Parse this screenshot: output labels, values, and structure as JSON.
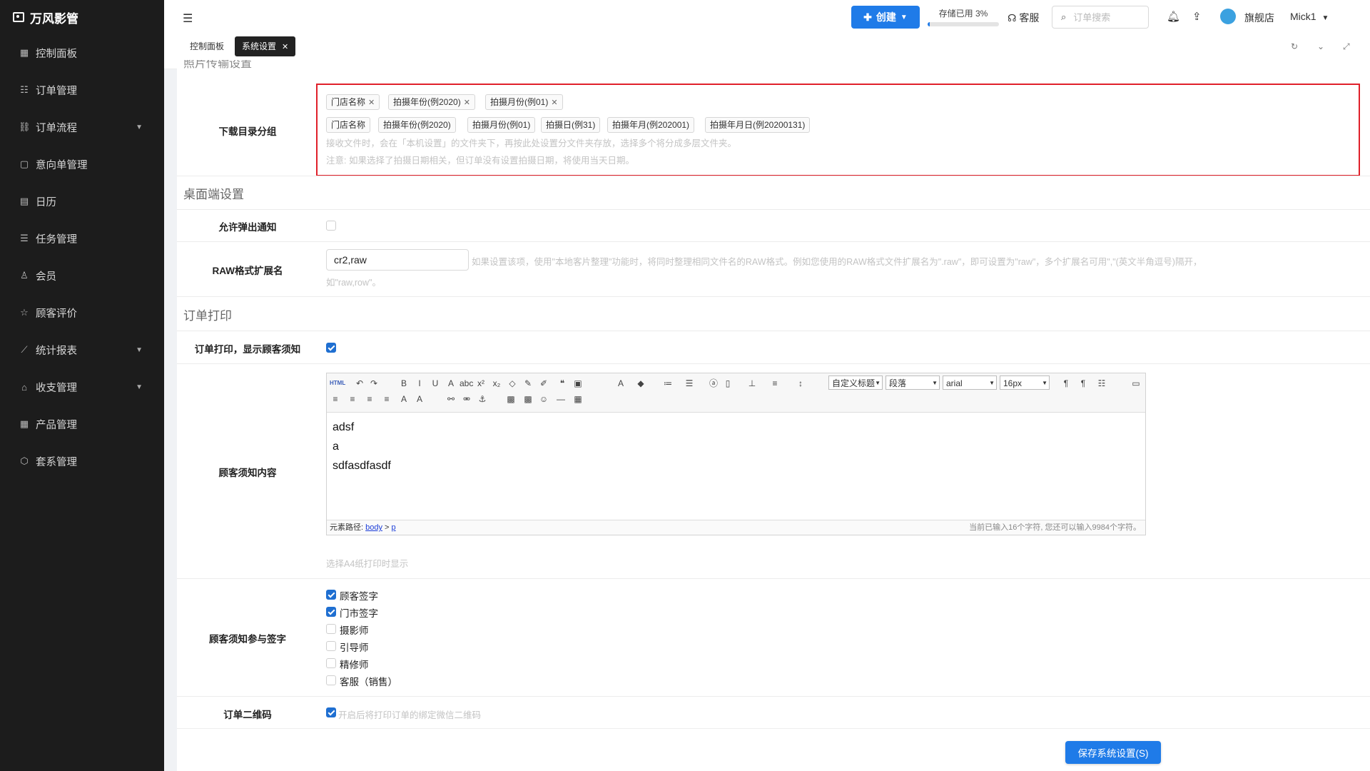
{
  "app": {
    "name": "万风影管"
  },
  "sidebar": {
    "items": [
      {
        "label": "控制面板",
        "icon": "▦",
        "chevron": false
      },
      {
        "label": "订单管理",
        "icon": "☷",
        "chevron": false
      },
      {
        "label": "订单流程",
        "icon": "⛓",
        "chevron": true
      },
      {
        "label": "意向单管理",
        "icon": "▢",
        "chevron": false
      },
      {
        "label": "日历",
        "icon": "▤",
        "chevron": false
      },
      {
        "label": "任务管理",
        "icon": "☰",
        "chevron": false
      },
      {
        "label": "会员",
        "icon": "♙",
        "chevron": false
      },
      {
        "label": "顾客评价",
        "icon": "☆",
        "chevron": false
      },
      {
        "label": "统计报表",
        "icon": "⟋",
        "chevron": true
      },
      {
        "label": "收支管理",
        "icon": "⌂",
        "chevron": true
      },
      {
        "label": "产品管理",
        "icon": "▦",
        "chevron": false
      },
      {
        "label": "套系管理",
        "icon": "⬡",
        "chevron": false
      }
    ]
  },
  "header": {
    "create_label": "创建",
    "storage_text": "存储已用 3%",
    "storage_percent": 3,
    "service_label": "客服",
    "search_placeholder": "订单搜索",
    "shop_label": "旗舰店",
    "user_label": "Mick1"
  },
  "tabs": {
    "home": "控制面板",
    "active": "系统设置"
  },
  "download": {
    "cut_title": "照片传输设置",
    "label": "下载目录分组",
    "selected": [
      "门店名称",
      "拍摄年份(例2020)",
      "拍摄月份(例01)"
    ],
    "options": [
      "门店名称",
      "拍摄年份(例2020)",
      "拍摄月份(例01)",
      "拍摄日(例31)",
      "拍摄年月(例202001)",
      "拍摄年月日(例20200131)"
    ],
    "hint1": "接收文件时，会在「本机设置」的文件夹下，再按此处设置分文件夹存放，选择多个将分成多层文件夹。",
    "hint2": "注意: 如果选择了拍摄日期相关，但订单没有设置拍摄日期，将使用当天日期。"
  },
  "desktop": {
    "title": "桌面端设置",
    "popup_label": "允许弹出通知",
    "popup_checked": false,
    "raw_label": "RAW格式扩展名",
    "raw_value": "cr2,raw",
    "raw_hint1": "如果设置该项，使用\"本地客片整理\"功能时，将同时整理相同文件名的RAW格式。例如您使用的RAW格式文件扩展名为\".raw\"，即可设置为\"raw\"，多个扩展名可用\",\"(英文半角逗号)隔开，",
    "raw_hint2": "如\"raw,row\"。"
  },
  "print": {
    "title": "订单打印",
    "show_notice_label": "订单打印，显示顾客须知",
    "show_notice_checked": true,
    "notice_label": "顾客须知内容",
    "editor": {
      "lines": [
        "adsf",
        "a",
        "sdfasdfasdf"
      ],
      "path_label": "元素路径: ",
      "path_body": "body",
      "path_sep": " > ",
      "path_p": "p",
      "count_text": "当前已输入16个字符, 您还可以输入9984个字符。",
      "sel_title": "自定义标题",
      "sel_para": "段落",
      "sel_font": "arial",
      "sel_size": "16px",
      "btn_html": "HTML"
    },
    "a4_hint": "选择A4纸打印时显示",
    "sign_label": "顾客须知参与签字",
    "sign_options": [
      {
        "label": "顾客签字",
        "checked": true
      },
      {
        "label": "门市签字",
        "checked": true
      },
      {
        "label": "摄影师",
        "checked": false
      },
      {
        "label": "引导师",
        "checked": false
      },
      {
        "label": "精修师",
        "checked": false
      },
      {
        "label": "客服（销售）",
        "checked": false
      }
    ],
    "qrcode_label": "订单二维码",
    "qrcode_checked": true,
    "qrcode_hint": "开启后将打印订单的绑定微信二维码"
  },
  "save_label": "保存系统设置(S)",
  "colors": {
    "primary": "#1f7be8",
    "sidebar": "#1c1c1c",
    "highlight_border": "#e0202a"
  }
}
